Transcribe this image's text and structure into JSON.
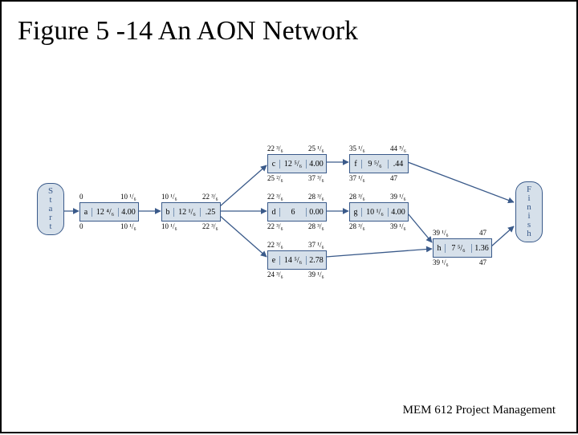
{
  "title": "Figure 5 -14 An AON Network",
  "footer": "MEM 612 Project Management",
  "terminals": {
    "start": "S\nt\na\nr\nt",
    "finish": "F\ni\nn\ni\ns\nh"
  },
  "nodes": {
    "a": {
      "id": "a",
      "te": "12 ⁴/₆",
      "var": "4.00",
      "es": "0",
      "ef": "10 ¹/₆",
      "ls": "0",
      "lf": "10 ¹/₆"
    },
    "b": {
      "id": "b",
      "te": "12 ¹/₆",
      "var": ".25",
      "es": "10 ¹/₆",
      "ef": "22 ³/₆",
      "ls": "10 ¹/₆",
      "lf": "22 ³/₆"
    },
    "c": {
      "id": "c",
      "te": "12 ⁵/₆",
      "var": "4.00",
      "es": "22 ³/₆",
      "ef": "25 ¹/₆",
      "ls": "25 ²/₆",
      "lf": "37 ³/₆"
    },
    "d": {
      "id": "d",
      "te": "6",
      "var": "0.00",
      "es": "22 ³/₆",
      "ef": "28 ³/₆",
      "ls": "22 ³/₆",
      "lf": "28 ³/₆"
    },
    "e": {
      "id": "e",
      "te": "14 ⁵/₆",
      "var": "2.78",
      "es": "22 ³/₆",
      "ef": "37 ¹/₆",
      "ls": "24 ³/₆",
      "lf": "39 ¹/₆"
    },
    "f": {
      "id": "f",
      "te": "9 ⁵/₆",
      "var": ".44",
      "es": "35 ¹/₆",
      "ef": "44 ⁵/₆",
      "ls": "37 ¹/₆",
      "lf": "47"
    },
    "g": {
      "id": "g",
      "te": "10 ¹/₆",
      "var": "4.00",
      "es": "28 ³/₆",
      "ef": "39 ¹/₆",
      "ls": "28 ³/₆",
      "lf": "39 ¹/₆"
    },
    "h": {
      "id": "h",
      "te": "7 ⁵/₆",
      "var": "1.36",
      "es": "39 ¹/₆",
      "ef": "47",
      "ls": "39 ¹/₆",
      "lf": "47"
    }
  },
  "chart_data": {
    "type": "diagram",
    "title": "An AON Network",
    "nodes": [
      {
        "id": "a",
        "te": "12 4/6",
        "var": 4.0,
        "es": "0",
        "ef": "10 1/6",
        "ls": "0",
        "lf": "10 1/6"
      },
      {
        "id": "b",
        "te": "12 1/6",
        "var": 0.25,
        "es": "10 1/6",
        "ef": "22 3/6",
        "ls": "10 1/6",
        "lf": "22 3/6"
      },
      {
        "id": "c",
        "te": "12 5/6",
        "var": 4.0,
        "es": "22 3/6",
        "ef": "25 1/6",
        "ls": "25 2/6",
        "lf": "37 3/6"
      },
      {
        "id": "d",
        "te": "6",
        "var": 0.0,
        "es": "22 3/6",
        "ef": "28 3/6",
        "ls": "22 3/6",
        "lf": "28 3/6"
      },
      {
        "id": "e",
        "te": "14 5/6",
        "var": 2.78,
        "es": "22 3/6",
        "ef": "37 1/6",
        "ls": "24 3/6",
        "lf": "39 1/6"
      },
      {
        "id": "f",
        "te": "9 5/6",
        "var": 0.44,
        "es": "35 1/6",
        "ef": "44 5/6",
        "ls": "37 1/6",
        "lf": "47"
      },
      {
        "id": "g",
        "te": "10 1/6",
        "var": 4.0,
        "es": "28 3/6",
        "ef": "39 1/6",
        "ls": "28 3/6",
        "lf": "39 1/6"
      },
      {
        "id": "h",
        "te": "7 5/6",
        "var": 1.36,
        "es": "39 1/6",
        "ef": "47",
        "ls": "39 1/6",
        "lf": "47"
      }
    ],
    "edges": [
      [
        "Start",
        "a"
      ],
      [
        "a",
        "b"
      ],
      [
        "b",
        "c"
      ],
      [
        "b",
        "d"
      ],
      [
        "b",
        "e"
      ],
      [
        "c",
        "f"
      ],
      [
        "d",
        "g"
      ],
      [
        "f",
        "Finish"
      ],
      [
        "g",
        "h"
      ],
      [
        "e",
        "h"
      ],
      [
        "h",
        "Finish"
      ]
    ]
  }
}
